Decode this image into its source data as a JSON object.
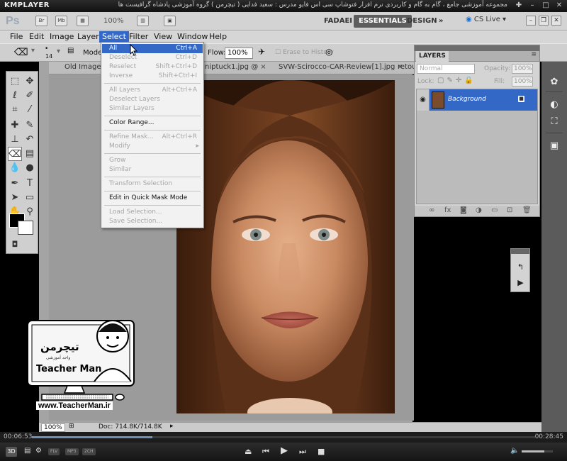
{
  "player": {
    "logo": "KMPLAYER",
    "caption": "مجموعه آموزشی جامع ، گام به گام و کاربردی نرم افزار فتوشاپ سی اس فایو مدرس : سعید فدایی ( تیچرمن ) گروه آموزشی پادشاه گرافیست ها",
    "time_elapsed": "00:06:53",
    "time_total": "00:28:45",
    "progress_fraction": 0.24,
    "volume_fraction": 0.72,
    "badges": [
      "3D",
      "FLV",
      "MP3",
      "2CH"
    ]
  },
  "appbar": {
    "logo": "Ps",
    "icons": [
      "Br",
      "Mb"
    ],
    "zoom": "100%",
    "workspaces": [
      "FADAEI",
      "ESSENTIALS",
      "DESIGN"
    ],
    "active_workspace": "ESSENTIALS",
    "more": "»",
    "cs_live": "CS Live"
  },
  "menubar": {
    "items": [
      "File",
      "Edit",
      "Image",
      "Layer",
      "Select",
      "Filter",
      "View",
      "Window",
      "Help"
    ],
    "open_item": "Select"
  },
  "options": {
    "brush_size": "14",
    "mode_label": "Mode:",
    "flow_label": "Flow:",
    "flow_value": "100%",
    "erase_history": "Erase to History"
  },
  "tabs": [
    "Old Image",
    "niptuck1.jpg @",
    "SVW-Scirocco-CAR-Review[1].jpg",
    "retou"
  ],
  "select_menu": [
    {
      "label": "All",
      "shortcut": "Ctrl+A",
      "state": "highlighted"
    },
    {
      "label": "Deselect",
      "shortcut": "Ctrl+D",
      "state": "disabled"
    },
    {
      "label": "Reselect",
      "shortcut": "Shift+Ctrl+D",
      "state": "disabled"
    },
    {
      "label": "Inverse",
      "shortcut": "Shift+Ctrl+I",
      "state": "disabled"
    },
    {
      "label": "All Layers",
      "shortcut": "Alt+Ctrl+A",
      "state": "disabled"
    },
    {
      "label": "Deselect Layers",
      "shortcut": "",
      "state": "disabled"
    },
    {
      "label": "Similar Layers",
      "shortcut": "",
      "state": "disabled"
    },
    {
      "label": "Color Range...",
      "shortcut": "",
      "state": "enabled"
    },
    {
      "label": "Refine Mask...",
      "shortcut": "Alt+Ctrl+R",
      "state": "disabled"
    },
    {
      "label": "Modify",
      "shortcut": "",
      "state": "disabled"
    },
    {
      "label": "Grow",
      "shortcut": "",
      "state": "disabled"
    },
    {
      "label": "Similar",
      "shortcut": "",
      "state": "disabled"
    },
    {
      "label": "Transform Selection",
      "shortcut": "",
      "state": "disabled"
    },
    {
      "label": "Edit in Quick Mask Mode",
      "shortcut": "",
      "state": "enabled"
    },
    {
      "label": "Load Selection...",
      "shortcut": "",
      "state": "disabled"
    },
    {
      "label": "Save Selection...",
      "shortcut": "",
      "state": "disabled"
    }
  ],
  "layers_panel": {
    "tab": "LAYERS",
    "blend_mode": "Normal",
    "opacity_label": "Opacity:",
    "opacity_value": "100%",
    "lock_label": "Lock:",
    "fill_label": "Fill:",
    "fill_value": "100%",
    "layers": [
      {
        "name": "Background",
        "selected": true,
        "visible": true,
        "locked": true
      }
    ]
  },
  "status": {
    "zoom": "100%",
    "doc": "Doc: 714.8K/714.8K"
  },
  "watermark": {
    "brand": "Teacher Man",
    "persian": "تیچرمن",
    "sub": "واحد آموزشی",
    "url": "www.TeacherMan.ir"
  },
  "colors": {
    "highlight": "#3468c7",
    "ui_gray": "#d3d3d3",
    "workspace_gray": "#a4a4a4",
    "player_dark": "#1c1c1c"
  }
}
